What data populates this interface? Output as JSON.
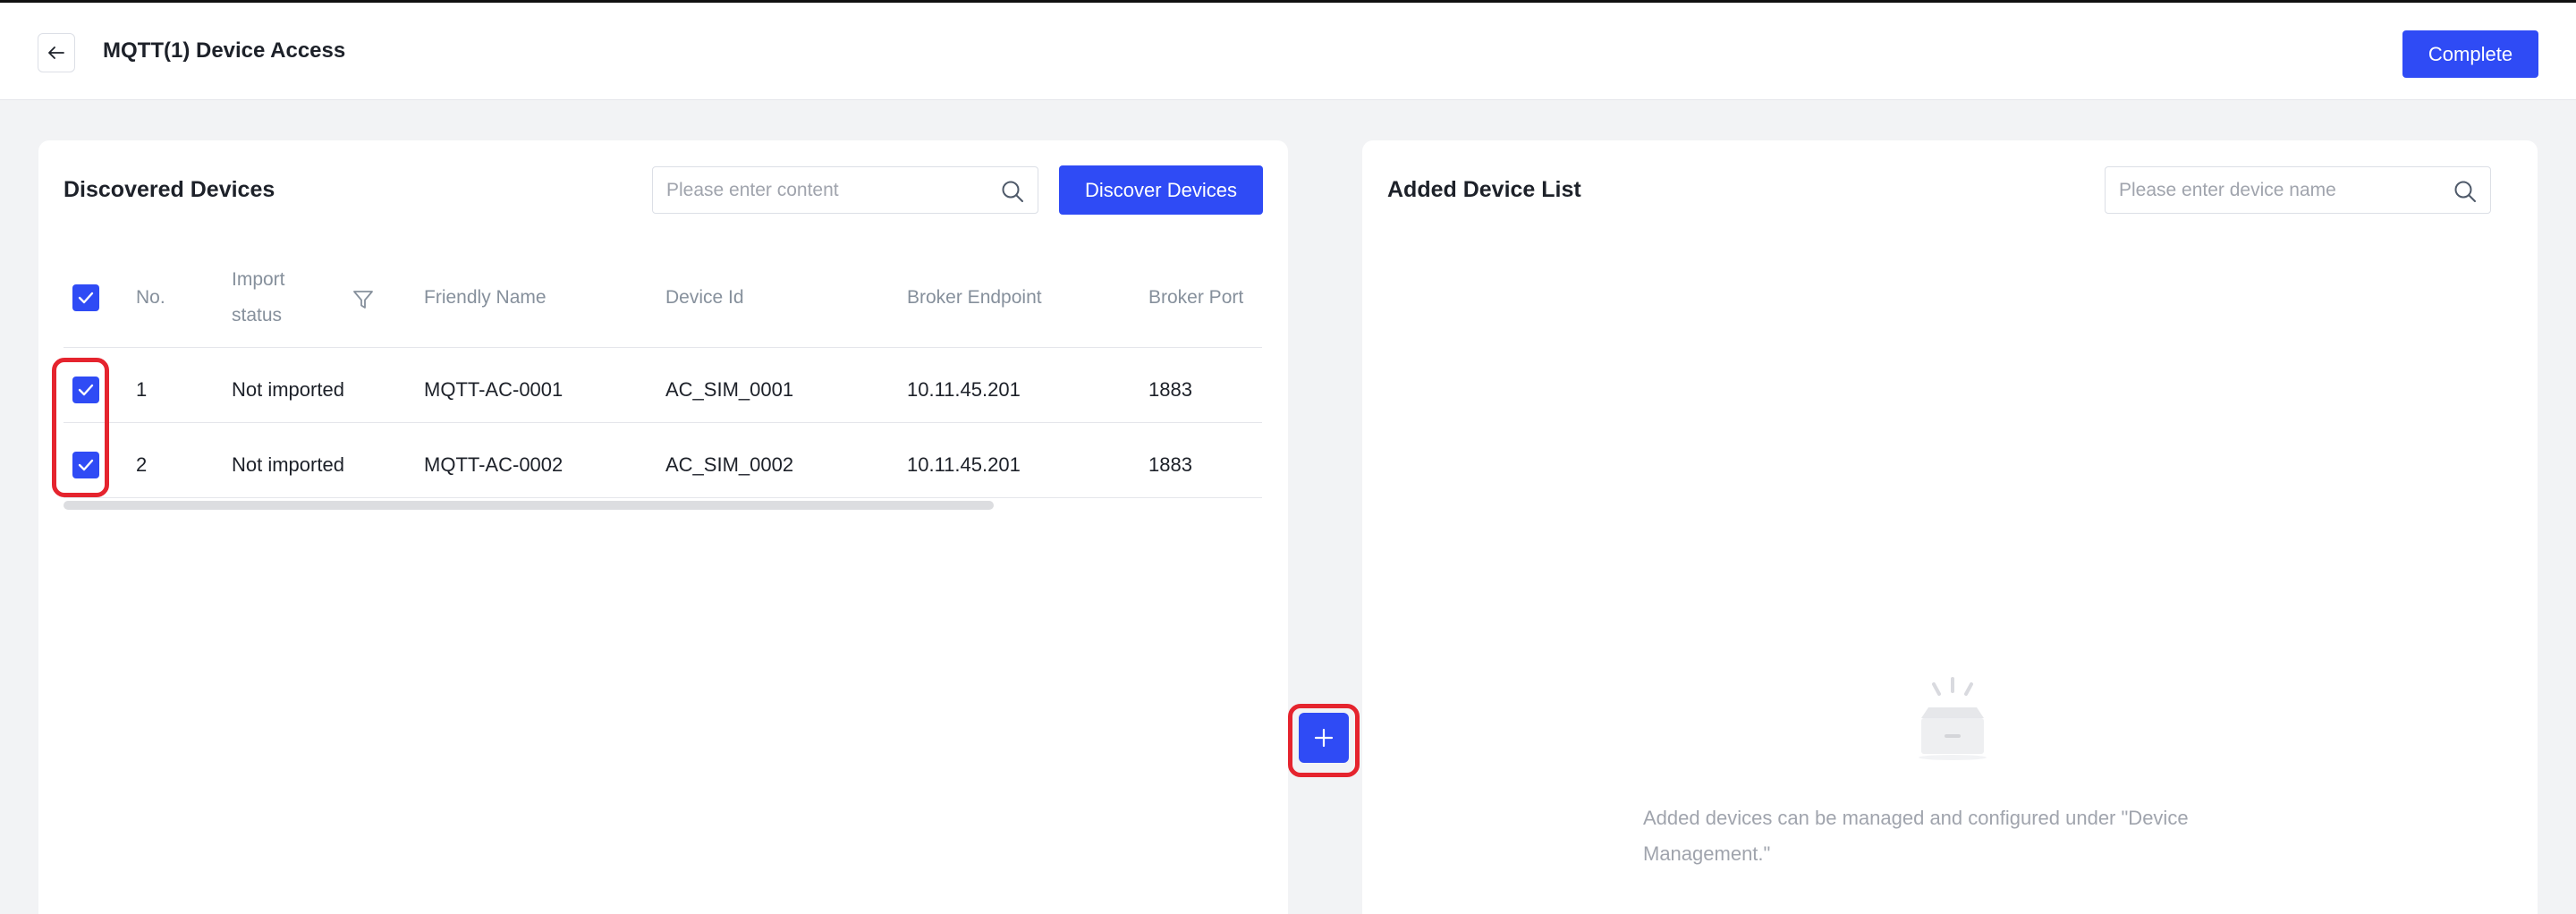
{
  "header": {
    "back_icon": "arrow-left-icon",
    "title": "MQTT(1) Device Access",
    "complete_label": "Complete"
  },
  "discovered": {
    "title": "Discovered Devices",
    "search_placeholder": "Please enter content",
    "discover_label": "Discover Devices",
    "columns": {
      "no": "No.",
      "import_status_line1": "Import",
      "import_status_line2": "status",
      "friendly_name": "Friendly Name",
      "device_id": "Device Id",
      "broker_endpoint": "Broker Endpoint",
      "broker_port": "Broker Port"
    },
    "rows": [
      {
        "no": "1",
        "import_status": "Not imported",
        "friendly_name": "MQTT-AC-0001",
        "device_id": "AC_SIM_0001",
        "broker_endpoint": "10.11.45.201",
        "broker_port": "1883",
        "checked": true
      },
      {
        "no": "2",
        "import_status": "Not imported",
        "friendly_name": "MQTT-AC-0002",
        "device_id": "AC_SIM_0002",
        "broker_endpoint": "10.11.45.201",
        "broker_port": "1883",
        "checked": true
      }
    ],
    "select_all_checked": true
  },
  "added": {
    "title": "Added Device List",
    "search_placeholder": "Please enter device name",
    "empty_line1": "Added devices can be managed and configured under \"Device",
    "empty_line2": "Management.\""
  },
  "colors": {
    "primary": "#2f4bf5",
    "highlight": "#e5242e",
    "background": "#f2f3f5"
  }
}
